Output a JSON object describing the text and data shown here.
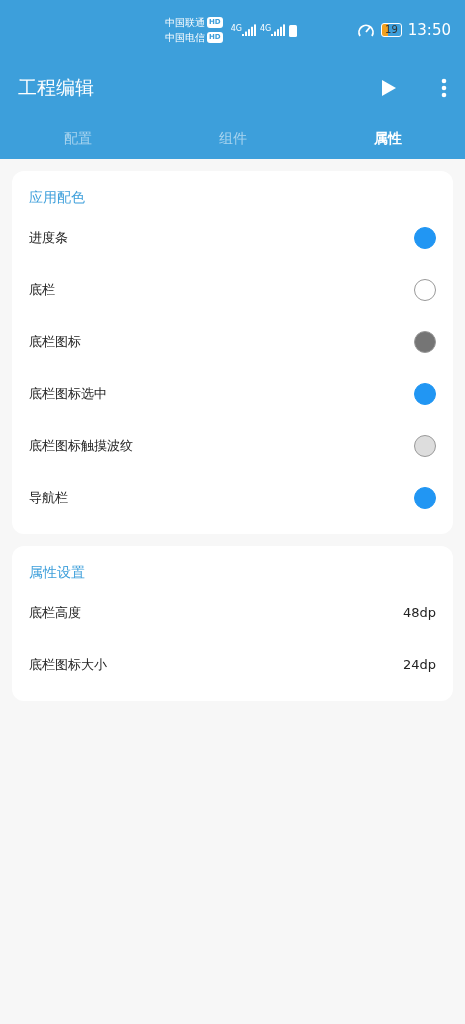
{
  "status_bar": {
    "carriers": [
      {
        "name": "中国联通",
        "badge": "HD"
      },
      {
        "name": "中国电信",
        "badge": "HD"
      }
    ],
    "network": [
      "4G",
      "4G"
    ],
    "battery": "19",
    "time": "13:50"
  },
  "toolbar": {
    "title": "工程编辑"
  },
  "tabs": [
    {
      "label": "配置",
      "selected": false
    },
    {
      "label": "组件",
      "selected": false
    },
    {
      "label": "属性",
      "selected": true
    }
  ],
  "sections": [
    {
      "title": "应用配色",
      "items": [
        {
          "kind": "color",
          "label": "进度条",
          "color": "#2196f3"
        },
        {
          "kind": "color",
          "label": "底栏",
          "color": "#ffffff"
        },
        {
          "kind": "color",
          "label": "底栏图标",
          "color": "#757575"
        },
        {
          "kind": "color",
          "label": "底栏图标选中",
          "color": "#2196f3"
        },
        {
          "kind": "color",
          "label": "底栏图标触摸波纹",
          "color": "#dddddd"
        },
        {
          "kind": "color",
          "label": "导航栏",
          "color": "#2196f3"
        }
      ]
    },
    {
      "title": "属性设置",
      "items": [
        {
          "kind": "value",
          "label": "底栏高度",
          "value": "48dp"
        },
        {
          "kind": "value",
          "label": "底栏图标大小",
          "value": "24dp"
        }
      ]
    }
  ]
}
